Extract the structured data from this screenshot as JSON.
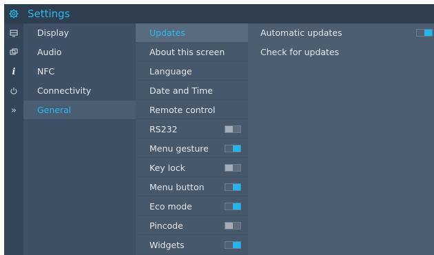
{
  "header": {
    "title": "Settings",
    "icon": "gear-icon"
  },
  "rail": {
    "icons": [
      "display-icon",
      "audio-icon",
      "info-icon",
      "power-icon",
      "expand-icon"
    ]
  },
  "categories": [
    {
      "label": "Display",
      "active": false
    },
    {
      "label": "Audio",
      "active": false
    },
    {
      "label": "NFC",
      "active": false
    },
    {
      "label": "Connectivity",
      "active": false
    },
    {
      "label": "General",
      "active": true
    }
  ],
  "general_items": [
    {
      "label": "Updates",
      "active": true,
      "toggle": null
    },
    {
      "label": "About this screen",
      "toggle": null
    },
    {
      "label": "Language",
      "toggle": null
    },
    {
      "label": "Date and Time",
      "toggle": null
    },
    {
      "label": "Remote control",
      "toggle": null
    },
    {
      "label": "RS232",
      "toggle": "off"
    },
    {
      "label": "Menu gesture",
      "toggle": "on"
    },
    {
      "label": "Key lock",
      "toggle": "off"
    },
    {
      "label": "Menu button",
      "toggle": "on"
    },
    {
      "label": "Eco mode",
      "toggle": "on"
    },
    {
      "label": "Pincode",
      "toggle": "off"
    },
    {
      "label": "Widgets",
      "toggle": "on"
    }
  ],
  "updates_options": [
    {
      "label": "Automatic updates",
      "toggle": "on"
    },
    {
      "label": "Check for updates",
      "toggle": null
    }
  ],
  "colors": {
    "accent": "#2fb7e8",
    "header_bg": "#2e3e51",
    "panel_bg": "#4a5b6e"
  }
}
